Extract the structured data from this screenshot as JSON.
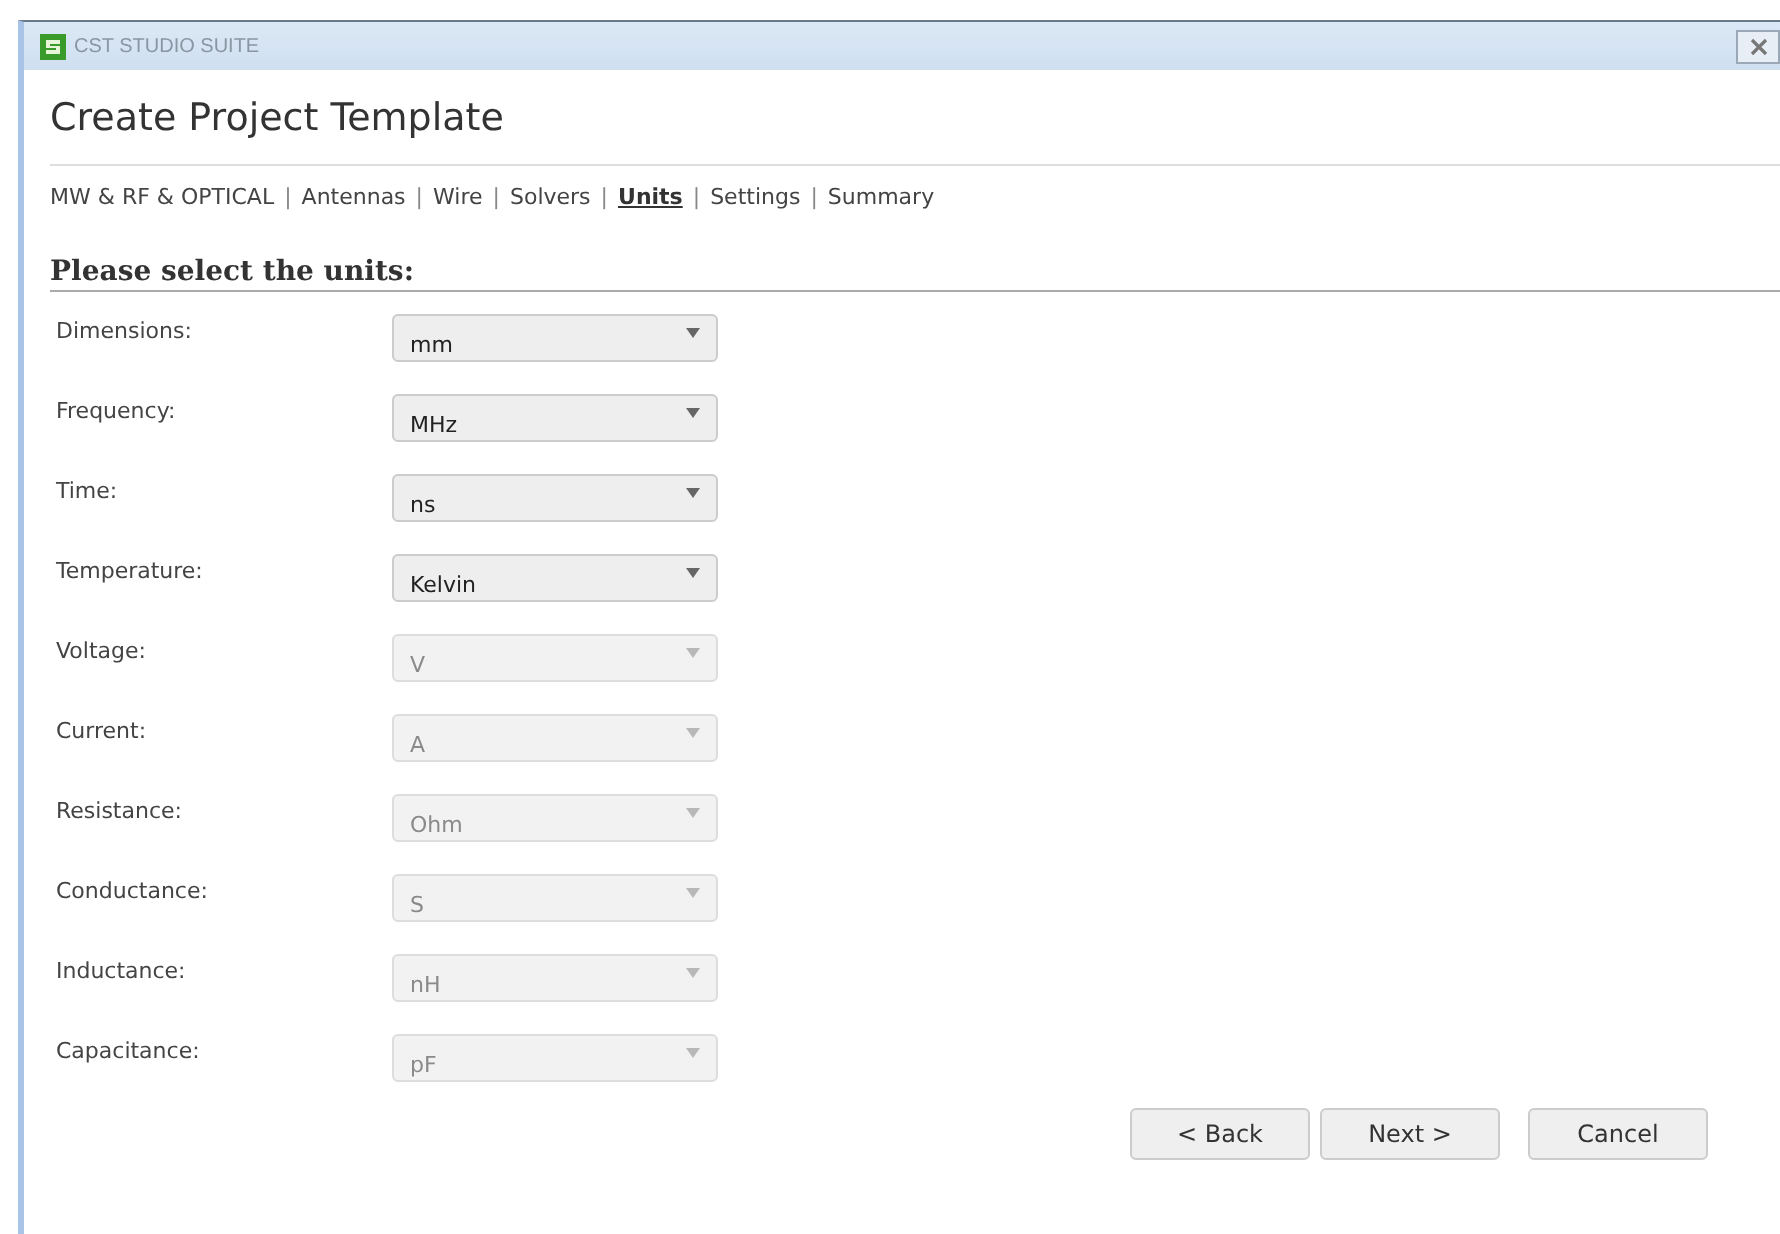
{
  "window": {
    "title": "CST STUDIO SUITE"
  },
  "page_title": "Create Project Template",
  "breadcrumb": {
    "separator": "|",
    "steps": [
      {
        "label": "MW & RF & OPTICAL",
        "selected": false
      },
      {
        "label": "Antennas",
        "selected": false
      },
      {
        "label": "Wire",
        "selected": false
      },
      {
        "label": "Solvers",
        "selected": false
      },
      {
        "label": "Units",
        "selected": true
      },
      {
        "label": "Settings",
        "selected": false
      },
      {
        "label": "Summary",
        "selected": false
      }
    ]
  },
  "heading": "Please select the units:",
  "units": [
    {
      "label": "Dimensions:",
      "value": "mm",
      "disabled": false
    },
    {
      "label": "Frequency:",
      "value": "MHz",
      "disabled": false
    },
    {
      "label": "Time:",
      "value": "ns",
      "disabled": false
    },
    {
      "label": "Temperature:",
      "value": "Kelvin",
      "disabled": false
    },
    {
      "label": "Voltage:",
      "value": "V",
      "disabled": true
    },
    {
      "label": "Current:",
      "value": "A",
      "disabled": true
    },
    {
      "label": "Resistance:",
      "value": "Ohm",
      "disabled": true
    },
    {
      "label": "Conductance:",
      "value": "S",
      "disabled": true
    },
    {
      "label": "Inductance:",
      "value": "nH",
      "disabled": true
    },
    {
      "label": "Capacitance:",
      "value": "pF",
      "disabled": true
    }
  ],
  "buttons": [
    {
      "label": "< Back"
    },
    {
      "label": "Next >"
    },
    {
      "label": "Cancel"
    }
  ]
}
